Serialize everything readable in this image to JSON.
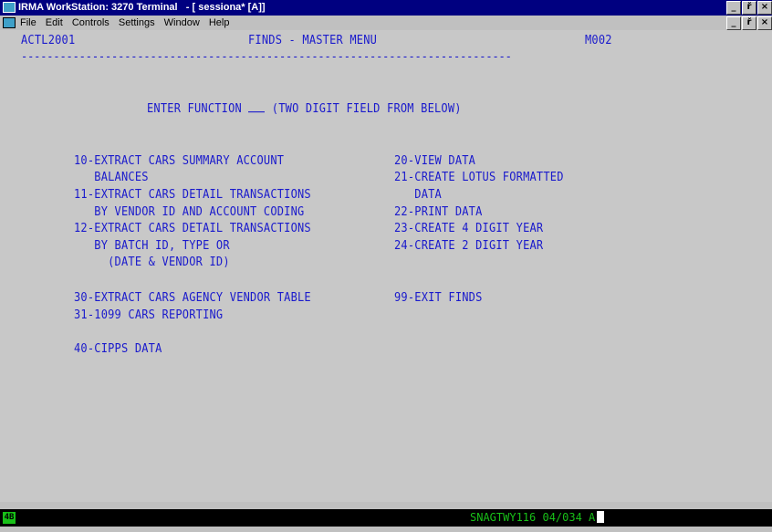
{
  "window": {
    "title": "IRMA WorkStation: 3270 Terminal   - [ sessiona* [A]]",
    "buttons": {
      "minimize": "_",
      "restore": "ř",
      "close": "×"
    }
  },
  "menubar": {
    "items": [
      "File",
      "Edit",
      "Controls",
      "Settings",
      "Window",
      "Help"
    ]
  },
  "terminal": {
    "header": {
      "program_id": "ACTL2001",
      "screen_title": "FINDS - MASTER MENU",
      "screen_code": "M002",
      "divider": "----------------------------------------------------------------------------"
    },
    "prompt": {
      "before": "ENTER FUNCTION ",
      "after": " (TWO DIGIT FIELD FROM BELOW)"
    },
    "left_options": [
      "10-EXTRACT CARS SUMMARY ACCOUNT",
      "   BALANCES",
      "11-EXTRACT CARS DETAIL TRANSACTIONS",
      "   BY VENDOR ID AND ACCOUNT CODING",
      "12-EXTRACT CARS DETAIL TRANSACTIONS",
      "   BY BATCH ID, TYPE OR",
      "     (DATE & VENDOR ID)"
    ],
    "right_options": [
      "20-VIEW DATA",
      "21-CREATE LOTUS FORMATTED",
      "   DATA",
      "22-PRINT DATA",
      "23-CREATE 4 DIGIT YEAR",
      "24-CREATE 2 DIGIT YEAR"
    ],
    "option_30": "30-EXTRACT CARS AGENCY VENDOR TABLE",
    "option_31": "31-1099 CARS REPORTING",
    "option_99": "99-EXIT FINDS",
    "option_40": "40-CIPPS DATA"
  },
  "status": {
    "badge": "4B",
    "session_info": "SNAGTWY116 04/034 A",
    "colors": {
      "status_text": "#18c018",
      "terminal_text": "#1a1acc",
      "title_bar": "#000080"
    }
  }
}
